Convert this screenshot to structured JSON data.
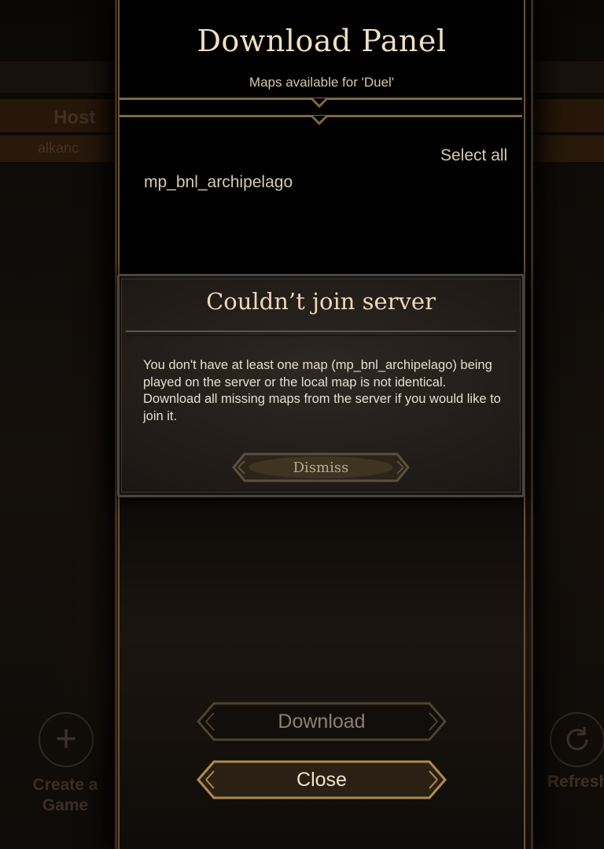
{
  "background": {
    "host_column_label": "Host",
    "host_row_value": "alkanc",
    "create_game_label": "Create a Game",
    "refresh_label": "Refresh",
    "create_icon": "plus-icon",
    "refresh_icon": "refresh-icon"
  },
  "download_panel": {
    "title": "Download Panel",
    "subtitle": "Maps available for 'Duel'",
    "select_all_label": "Select all",
    "maps": [
      "mp_bnl_archipelago"
    ],
    "download_button": "Download",
    "close_button": "Close"
  },
  "dialog": {
    "title": "Couldn’t join server",
    "message": "You don't have at least one map (mp_bnl_archipelago) being played on the server or the local map is not identical. Download all missing maps from the server if you would like to join it.",
    "dismiss_button": "Dismiss"
  },
  "colors": {
    "gold_border": "#7e6746",
    "title_text": "#f1dfbf",
    "body_text": "#d8cab2"
  }
}
